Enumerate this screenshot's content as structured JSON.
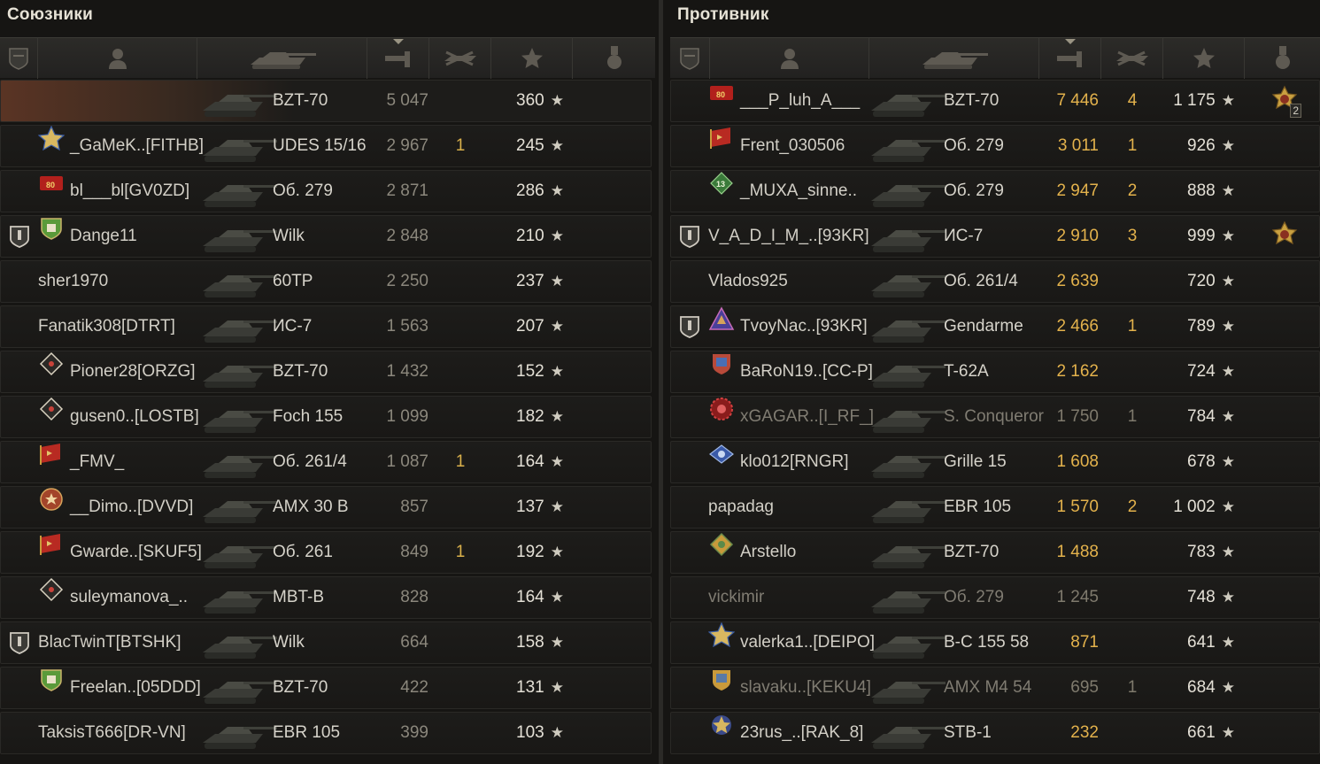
{
  "allies": {
    "title": "Союзники",
    "rows": [
      {
        "platoon": false,
        "badge": "",
        "name": "",
        "vehicle": "BZT-70",
        "damage": "5 047",
        "kills": "",
        "xp": "360",
        "player": true,
        "dead": false
      },
      {
        "platoon": false,
        "badge": "star-badge-icon",
        "name": "_GaMeK..[FITHB]",
        "vehicle": "UDES 15/16",
        "damage": "2 967",
        "kills": "1",
        "xp": "245",
        "player": false,
        "dead": false
      },
      {
        "platoon": false,
        "badge": "flag-80-badge-icon",
        "name": "bl___bl[GV0ZD]",
        "vehicle": "Об. 279",
        "damage": "2 871",
        "kills": "",
        "xp": "286",
        "player": false,
        "dead": false
      },
      {
        "platoon": true,
        "badge": "shield-badge-icon",
        "name": "Dange11",
        "vehicle": "Wilk",
        "damage": "2 848",
        "kills": "",
        "xp": "210",
        "player": false,
        "dead": false
      },
      {
        "platoon": false,
        "badge": "",
        "name": "sher1970",
        "vehicle": "60TP",
        "damage": "2 250",
        "kills": "",
        "xp": "237",
        "player": false,
        "dead": false
      },
      {
        "platoon": false,
        "badge": "",
        "name": "Fanatik308[DTRT]",
        "vehicle": "ИС-7",
        "damage": "1 563",
        "kills": "",
        "xp": "207",
        "player": false,
        "dead": false
      },
      {
        "platoon": false,
        "badge": "diamond-badge-icon",
        "name": "Pioner28[ORZG]",
        "vehicle": "BZT-70",
        "damage": "1 432",
        "kills": "",
        "xp": "152",
        "player": false,
        "dead": false
      },
      {
        "platoon": false,
        "badge": "diamond-badge-icon",
        "name": "gusen0..[LOSTB]",
        "vehicle": "Foch 155",
        "damage": "1 099",
        "kills": "",
        "xp": "182",
        "player": false,
        "dead": false
      },
      {
        "platoon": false,
        "badge": "flag-badge-icon",
        "name": "_FMV_",
        "vehicle": "Об. 261/4",
        "damage": "1 087",
        "kills": "1",
        "xp": "164",
        "player": false,
        "dead": false
      },
      {
        "platoon": false,
        "badge": "emblem-badge-icon",
        "name": "__Dimo..[DVVD]",
        "vehicle": "AMX 30 B",
        "damage": "857",
        "kills": "",
        "xp": "137",
        "player": false,
        "dead": false
      },
      {
        "platoon": false,
        "badge": "flag-badge-icon",
        "name": "Gwarde..[SKUF5]",
        "vehicle": "Об. 261",
        "damage": "849",
        "kills": "1",
        "xp": "192",
        "player": false,
        "dead": false
      },
      {
        "platoon": false,
        "badge": "diamond-badge-icon",
        "name": "suleymanova_..",
        "vehicle": "MBT-B",
        "damage": "828",
        "kills": "",
        "xp": "164",
        "player": false,
        "dead": false
      },
      {
        "platoon": true,
        "badge": "",
        "name": "BlacTwinT[BTSHK]",
        "vehicle": "Wilk",
        "damage": "664",
        "kills": "",
        "xp": "158",
        "player": false,
        "dead": false
      },
      {
        "platoon": false,
        "badge": "shield-badge-icon",
        "name": "Freelan..[05DDD]",
        "vehicle": "BZT-70",
        "damage": "422",
        "kills": "",
        "xp": "131",
        "player": false,
        "dead": false
      },
      {
        "platoon": false,
        "badge": "",
        "name": "TaksisT666[DR-VN]",
        "vehicle": "EBR 105",
        "damage": "399",
        "kills": "",
        "xp": "103",
        "player": false,
        "dead": false
      }
    ]
  },
  "enemies": {
    "title": "Противник",
    "rows": [
      {
        "platoon": false,
        "badge": "flag-80-badge-icon",
        "name": "___P_luh_A___",
        "vehicle": "BZT-70",
        "damage": "7 446",
        "kills": "4",
        "xp": "1 175",
        "medal": "order-medal-icon",
        "medal_count": "2",
        "dead": false
      },
      {
        "platoon": false,
        "badge": "flag-badge-icon",
        "name": "Frent_030506",
        "vehicle": "Об. 279",
        "damage": "3 011",
        "kills": "1",
        "xp": "926",
        "medal": "",
        "medal_count": "",
        "dead": false
      },
      {
        "platoon": false,
        "badge": "green-13-badge-icon",
        "name": "_MUXA_sinne..",
        "vehicle": "Об. 279",
        "damage": "2 947",
        "kills": "2",
        "xp": "888",
        "medal": "",
        "medal_count": "",
        "dead": false
      },
      {
        "platoon": true,
        "badge": "",
        "name": "V_A_D_I_M_..[93KR]",
        "vehicle": "ИС-7",
        "damage": "2 910",
        "kills": "3",
        "xp": "999",
        "medal": "order-medal-icon",
        "medal_count": "",
        "dead": false
      },
      {
        "platoon": false,
        "badge": "",
        "name": "Vlados925",
        "vehicle": "Об. 261/4",
        "damage": "2 639",
        "kills": "",
        "xp": "720",
        "medal": "",
        "medal_count": "",
        "dead": false
      },
      {
        "platoon": true,
        "badge": "triangle-badge-icon",
        "name": "TvoyNac..[93KR]",
        "vehicle": "Gendarme",
        "damage": "2 466",
        "kills": "1",
        "xp": "789",
        "medal": "",
        "medal_count": "",
        "dead": false
      },
      {
        "platoon": false,
        "badge": "crest-badge-icon",
        "name": "BaRoN19..[CC-P]",
        "vehicle": "T-62A",
        "damage": "2 162",
        "kills": "",
        "xp": "724",
        "medal": "",
        "medal_count": "",
        "dead": false
      },
      {
        "platoon": false,
        "badge": "red-gear-badge-icon",
        "name": "xGAGAR..[I_RF_]",
        "vehicle": "S. Conqueror",
        "damage": "1 750",
        "kills": "1",
        "xp": "784",
        "medal": "",
        "medal_count": "",
        "dead": true
      },
      {
        "platoon": false,
        "badge": "blue-wings-badge-icon",
        "name": "klo012[RNGR]",
        "vehicle": "Grille 15",
        "damage": "1 608",
        "kills": "",
        "xp": "678",
        "medal": "",
        "medal_count": "",
        "dead": false
      },
      {
        "platoon": false,
        "badge": "",
        "name": "papadag",
        "vehicle": "EBR 105",
        "damage": "1 570",
        "kills": "2",
        "xp": "1 002",
        "medal": "",
        "medal_count": "",
        "dead": false
      },
      {
        "platoon": false,
        "badge": "gold-diamond-badge-icon",
        "name": "Arstello",
        "vehicle": "BZT-70",
        "damage": "1 488",
        "kills": "",
        "xp": "783",
        "medal": "",
        "medal_count": "",
        "dead": false
      },
      {
        "platoon": false,
        "badge": "",
        "name": "vickimir",
        "vehicle": "Об. 279",
        "damage": "1 245",
        "kills": "",
        "xp": "748",
        "medal": "",
        "medal_count": "",
        "dead": true
      },
      {
        "platoon": false,
        "badge": "star-badge-icon",
        "name": "valerka1..[DEIPO]",
        "vehicle": "B-C 155 58",
        "damage": "871",
        "kills": "",
        "xp": "641",
        "medal": "",
        "medal_count": "",
        "dead": false
      },
      {
        "platoon": false,
        "badge": "gold-crest-badge-icon",
        "name": "slavaku..[KEKU4]",
        "vehicle": "AMX M4 54",
        "damage": "695",
        "kills": "1",
        "xp": "684",
        "medal": "",
        "medal_count": "",
        "dead": true
      },
      {
        "platoon": false,
        "badge": "star-blue-badge-icon",
        "name": "23rus_..[RAK_8]",
        "vehicle": "STB-1",
        "damage": "232",
        "kills": "",
        "xp": "661",
        "medal": "",
        "medal_count": "",
        "dead": false
      }
    ]
  },
  "colors": {
    "background": "#161513",
    "row": "#1d1c1a",
    "player_highlight": "#5a3424",
    "enemy_value": "#e3b24c",
    "ally_kills": "#d9b04b",
    "text": "#d2cfc6"
  },
  "icons": {
    "header_platoon": "platoon-icon",
    "header_player": "player-icon",
    "header_vehicle": "tank-icon",
    "header_damage": "damage-icon",
    "header_kills": "kills-icon",
    "header_xp": "star-icon",
    "header_medal": "medal-icon",
    "xp_suffix": "★"
  }
}
